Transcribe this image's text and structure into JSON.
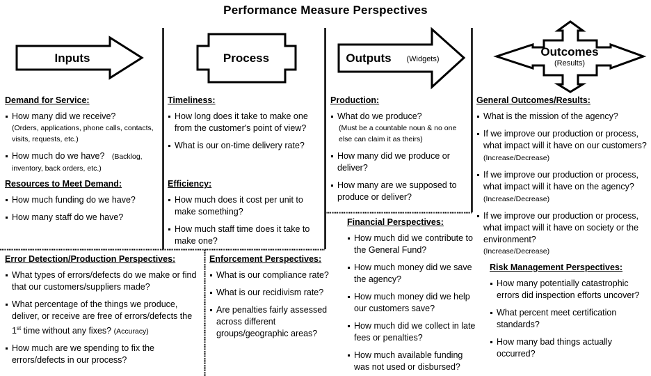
{
  "title": "Performance Measure Perspectives",
  "shapes": {
    "inputs": {
      "label": "Inputs",
      "icon": "right-arrow-shape"
    },
    "process": {
      "label": "Process",
      "icon": "process-box-shape"
    },
    "outputs": {
      "label": "Outputs",
      "sublabel": "(Widgets)",
      "icon": "right-arrow-shape"
    },
    "outcomes": {
      "label": "Outcomes",
      "sublabel": "(Results)",
      "icon": "four-way-arrow-shape"
    }
  },
  "sections": {
    "demand": {
      "heading": "Demand for Service:",
      "items": [
        {
          "text": "How many did we receive?",
          "note": "(Orders, applications, phone calls, contacts, visits, requests, etc.)"
        },
        {
          "text": "How much do we have?",
          "note": "(Backlog, inventory, back orders, etc.)"
        }
      ]
    },
    "resources": {
      "heading": "Resources to Meet Demand:",
      "items": [
        {
          "text": "How much funding do we have?"
        },
        {
          "text": "How many staff do we have?"
        }
      ]
    },
    "timeliness": {
      "heading": "Timeliness:",
      "items": [
        {
          "text": "How long does it take to make one from the customer's point of view?"
        },
        {
          "text": "What is our on-time delivery rate?"
        }
      ]
    },
    "efficiency": {
      "heading": "Efficiency:",
      "items": [
        {
          "text": "How much does it cost per unit to make something?"
        },
        {
          "text": "How much staff time does it take to make one?"
        }
      ]
    },
    "production": {
      "heading": "Production:",
      "items": [
        {
          "text": "What do we produce?",
          "note": "(Must be a countable noun & no one else can claim it as theirs)"
        },
        {
          "text": "How many did we produce or deliver?"
        },
        {
          "text": "How many are we supposed to produce or deliver?"
        }
      ]
    },
    "general_outcomes": {
      "heading": "General Outcomes/Results:",
      "items": [
        {
          "text": "What is the mission of the agency?"
        },
        {
          "text": "If we improve our production or process, what impact will it have on our customers?",
          "note": "(Increase/Decrease)"
        },
        {
          "text": "If we improve our production or process, what impact will it have on the agency?",
          "note": "(Increase/Decrease)"
        },
        {
          "text": "If we improve our production or process, what impact will it have on society or the environment?",
          "note": "(Increase/Decrease)"
        }
      ]
    },
    "error_detection": {
      "heading": "Error Detection/Production Perspectives:",
      "items": [
        {
          "text": "What types of errors/defects do we make or find that our customers/suppliers made?"
        },
        {
          "text_pre": "What percentage of the things we produce, deliver, or receive are free of errors/defects the 1",
          "sup": "st",
          "text_post": " time without any fixes?",
          "note": "(Accuracy)"
        },
        {
          "text": "How much are we spending to fix the errors/defects in our process?"
        }
      ]
    },
    "enforcement": {
      "heading": "Enforcement Perspectives:",
      "items": [
        {
          "text": "What is our compliance rate?"
        },
        {
          "text": "What is our recidivism rate?"
        },
        {
          "text": "Are penalties fairly assessed across different groups/geographic areas?"
        }
      ]
    },
    "financial": {
      "heading": "Financial Perspectives:",
      "items": [
        {
          "text": "How much did we contribute to the General Fund?"
        },
        {
          "text": "How much money did we save the agency?"
        },
        {
          "text": "How much money did we help our customers save?"
        },
        {
          "text": "How much did we collect in late fees or penalties?"
        },
        {
          "text": "How much available funding was not used or disbursed?"
        }
      ]
    },
    "risk": {
      "heading": "Risk Management Perspectives:",
      "items": [
        {
          "text": "How many potentially catastrophic errors did inspection efforts uncover?"
        },
        {
          "text": "What percent meet certification standards?"
        },
        {
          "text": "How many bad things actually occurred?"
        }
      ]
    }
  }
}
